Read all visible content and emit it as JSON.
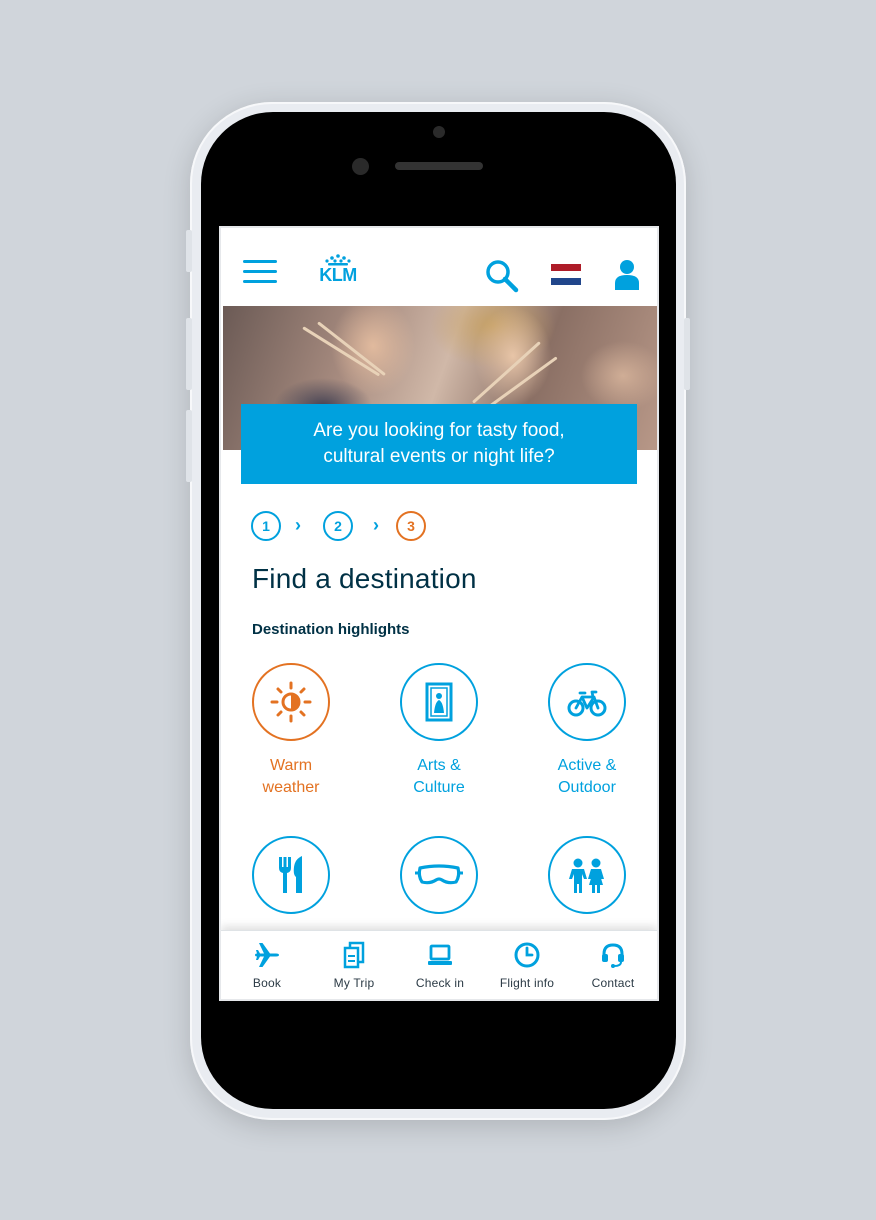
{
  "header": {
    "logo_text": "KLM",
    "flag_colors": [
      "#ae1c28",
      "#ffffff",
      "#21468b"
    ]
  },
  "hero": {
    "banner_line1": "Are you looking for tasty food,",
    "banner_line2": "cultural events or night life?"
  },
  "steps": [
    {
      "label": "1",
      "state": "done"
    },
    {
      "label": "2",
      "state": "done"
    },
    {
      "label": "3",
      "state": "active"
    }
  ],
  "page_title": "Find a destination",
  "section_title": "Destination highlights",
  "highlights": [
    {
      "line1": "Warm",
      "line2": "weather",
      "icon": "sun-icon",
      "active": true
    },
    {
      "line1": "Arts &",
      "line2": "Culture",
      "icon": "painting-icon",
      "active": false
    },
    {
      "line1": "Active &",
      "line2": "Outdoor",
      "icon": "bicycle-icon",
      "active": false
    },
    {
      "line1": "",
      "line2": "",
      "icon": "cutlery-icon",
      "active": false
    },
    {
      "line1": "",
      "line2": "",
      "icon": "ski-goggles-icon",
      "active": false
    },
    {
      "line1": "",
      "line2": "",
      "icon": "family-icon",
      "active": false
    }
  ],
  "tabs": [
    {
      "label": "Book",
      "icon": "airplane-icon"
    },
    {
      "label": "My Trip",
      "icon": "documents-icon"
    },
    {
      "label": "Check in",
      "icon": "laptop-icon"
    },
    {
      "label": "Flight info",
      "icon": "clock-icon"
    },
    {
      "label": "Contact",
      "icon": "headset-icon"
    }
  ],
  "colors": {
    "brand_blue": "#00a1de",
    "accent_orange": "#e37222",
    "dark_text": "#003145"
  }
}
